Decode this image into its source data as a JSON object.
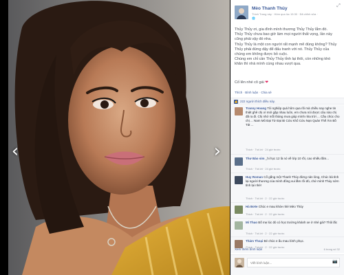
{
  "viewer": {
    "prev_icon": "chevron-left-icon",
    "next_icon": "chevron-right-icon",
    "expand_icon": "expand-icon"
  },
  "post": {
    "author": "Mèo Thanh Thủy",
    "meta": "Thích Trang này · Hôm qua lúc 15:30 · Đã chỉnh sửa ·",
    "audience_icon": "globe-icon",
    "caption_lines": [
      "Thủy Thủy ơi, gia đình mình thương Thủy Thủy lắm đó.",
      "Thủy Thủy chưa bao giờ làm mọi người thất vọng, lần này cũng phải vậy đó nha.",
      "Thủy Thủy là một con người rất mạnh mẽ đúng không? Thủy Thủy phải đứng dậy để đấu tranh với nó. Thủy Thủy của chúng em không được bỏ cuộc.",
      "Chúng em chỉ cần Thủy Thủy tỉnh lại thôi, còn những khó khăn thì nhà mình cùng nhau vượt qua."
    ],
    "signoff": "Cố lên nhé cô gái",
    "actions": [
      "Thích",
      "Bình luận",
      "Chia sẻ"
    ],
    "likes_text": "222 người thích điều này."
  },
  "comments": [
    {
      "author": "Tranny Hoang",
      "text": "Tôi nghiệp quá hôm qua rồi mà chiều nay nghe tin thiệt ghê chị ơi mới gặp nhau luôn, em chưa nói được câu nào chị đã ra đi. Chị nhớ mỗi tháng mưa giúp mình nha trời ... Cầu chúc cho chị ... Nam Mô Đại Từ Đại Bi Cứu Khổ Cứu Nạn Quán Thế Âm Bồ Tát ...",
      "meta": "Thích · Trả lời · 24 giờ trước",
      "likes": ""
    },
    {
      "author": "Thư Bảo sim",
      "text": "_hi học 12 là nó về lớp 10 rồi, cao nhiều lắm...",
      "meta": "Thích · Trả lời · 24 giờ trước",
      "likes": "1"
    },
    {
      "author": "Huy Roman",
      "text": "Cố gắng một Thanh Thủy đừng nản lòng, Chúc bà tỉnh lại người thương của mình đông vui lắm rồi đó, chứ mình Thủy sớm tỉnh lại nhé!",
      "meta": "Thích · Trả lời · 2 · 22 giờ trước",
      "likes": "2"
    },
    {
      "author": "Hà Bơte",
      "text": "Chúc e mau khỏe nhé Mèo Thủy",
      "meta": "Thích · Trả lời · 2 · 22 giờ trước",
      "likes": "2"
    },
    {
      "author": "Mi Thao",
      "text": "Bố mẹ lúc đó có học trường khánh xe ở nhé gái? Thôi lắc",
      "meta": "Thích · Trả lời · 2 · 22 giờ trước",
      "likes": "2"
    },
    {
      "author": "Thảm Thoại",
      "text": "Bé chúc e ấu mau bình phục.",
      "meta": "Thích · Trả lời · 2 · 22 giờ trước",
      "likes": "2"
    }
  ],
  "more_comments": "Xem thêm bình luận",
  "pager": "6 trong số 32",
  "composer": {
    "placeholder": "Viết bình luận...",
    "camera_icon": "camera-icon"
  },
  "colors": {
    "link": "#3b5998",
    "panel_bg": "#ffffff",
    "comment_bg": "#f6f7f9",
    "heart": "#e0245e"
  }
}
